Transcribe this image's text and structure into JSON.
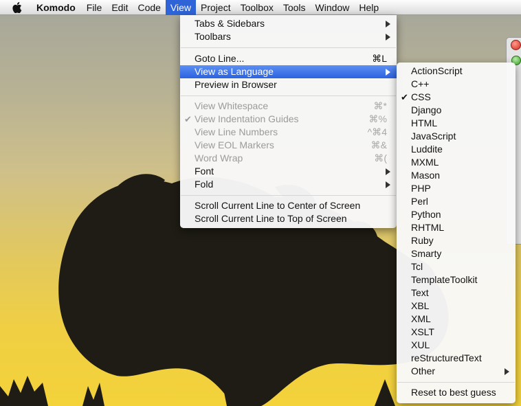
{
  "menubar": {
    "app_name": "Komodo",
    "menus": [
      "File",
      "Edit",
      "Code",
      "View",
      "Project",
      "Toolbox",
      "Tools",
      "Window",
      "Help"
    ],
    "active_menu": "View"
  },
  "view_menu": {
    "tabs_sidebars": "Tabs & Sidebars",
    "toolbars": "Toolbars",
    "goto_line": "Goto Line...",
    "goto_line_shortcut": "⌘L",
    "view_as_language": "View as Language",
    "preview_in_browser": "Preview in Browser",
    "view_whitespace": "View Whitespace",
    "view_whitespace_shortcut": "⌘*",
    "view_indentation_guides": "View Indentation Guides",
    "view_indentation_guides_shortcut": "⌘%",
    "view_line_numbers": "View Line Numbers",
    "view_line_numbers_shortcut": "^⌘4",
    "view_eol_markers": "View EOL Markers",
    "view_eol_markers_shortcut": "⌘&",
    "word_wrap": "Word Wrap",
    "word_wrap_shortcut": "⌘(",
    "font": "Font",
    "fold": "Fold",
    "scroll_center": "Scroll Current Line to Center of Screen",
    "scroll_top": "Scroll Current Line to Top of Screen",
    "check_mark": "✔"
  },
  "language_menu": {
    "languages": [
      "ActionScript",
      "C++",
      "CSS",
      "Django",
      "HTML",
      "JavaScript",
      "Luddite",
      "MXML",
      "Mason",
      "PHP",
      "Perl",
      "Python",
      "RHTML",
      "Ruby",
      "Smarty",
      "Tcl",
      "TemplateToolkit",
      "Text",
      "XBL",
      "XML",
      "XSLT",
      "XUL",
      "reStructuredText"
    ],
    "checked": "CSS",
    "other": "Other",
    "reset": "Reset to best guess",
    "check_mark": "✔"
  },
  "colors": {
    "highlight": "#2f64d8",
    "disabled_text": "#9b9b9b"
  },
  "icons": {
    "apple": "apple-logo-icon",
    "submenu": "submenu-arrow-icon",
    "check": "checkmark-icon"
  }
}
